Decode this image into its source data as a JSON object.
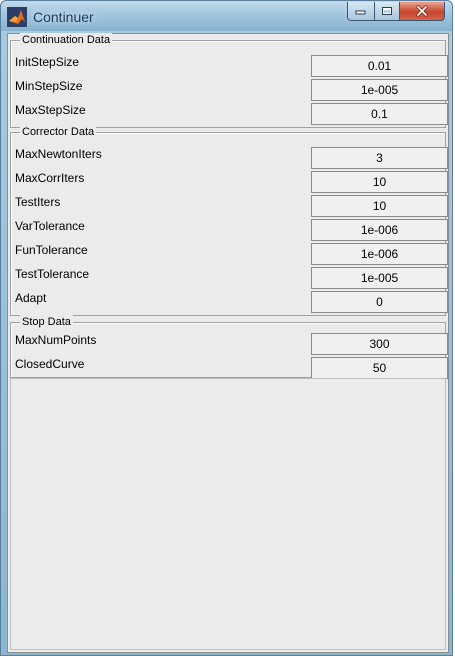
{
  "window": {
    "title": "Continuer",
    "controls": {
      "minimize_icon": "minimize-icon",
      "maximize_icon": "maximize-icon",
      "close_icon": "close-icon"
    }
  },
  "groups": [
    {
      "title": "Continuation Data",
      "rows": [
        {
          "label": "InitStepSize",
          "value": "0.01"
        },
        {
          "label": "MinStepSize",
          "value": "1e-005"
        },
        {
          "label": "MaxStepSize",
          "value": "0.1"
        }
      ]
    },
    {
      "title": "Corrector Data",
      "rows": [
        {
          "label": "MaxNewtonIters",
          "value": "3"
        },
        {
          "label": "MaxCorrIters",
          "value": "10"
        },
        {
          "label": "TestIters",
          "value": "10"
        },
        {
          "label": "VarTolerance",
          "value": "1e-006"
        },
        {
          "label": "FunTolerance",
          "value": "1e-006"
        },
        {
          "label": "TestTolerance",
          "value": "1e-005"
        },
        {
          "label": "Adapt",
          "value": "0"
        }
      ]
    },
    {
      "title": "Stop Data",
      "rows": [
        {
          "label": "MaxNumPoints",
          "value": "300"
        },
        {
          "label": "ClosedCurve",
          "value": "50"
        }
      ]
    }
  ],
  "colors": {
    "titlebar": "#a2c6df",
    "close_button": "#c8452c",
    "panel_background": "#ebebeb"
  }
}
